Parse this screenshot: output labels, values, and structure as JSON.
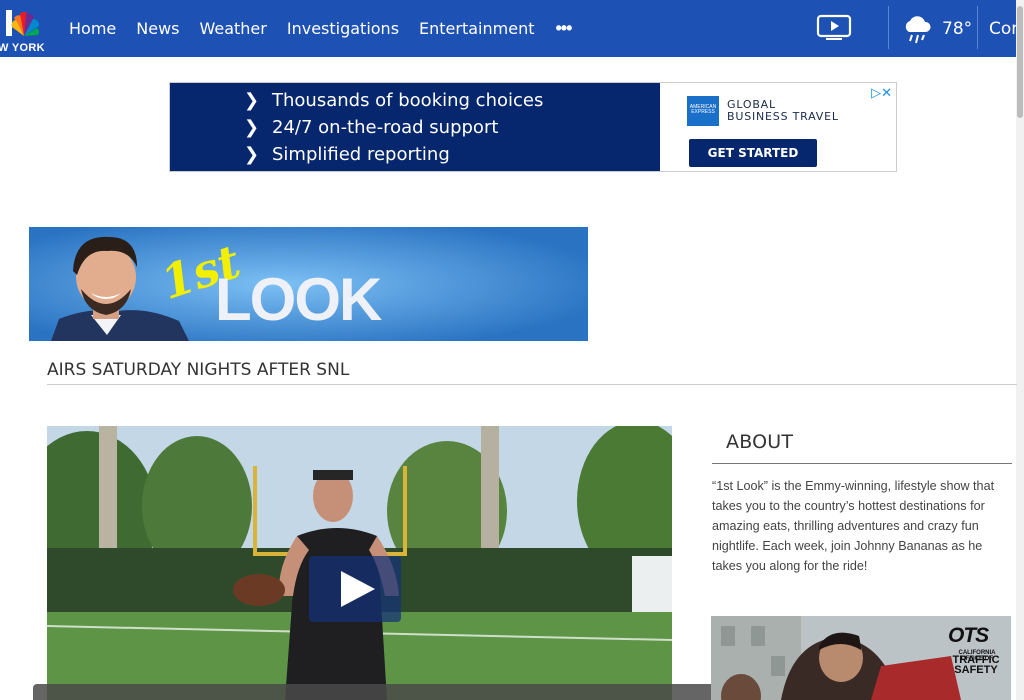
{
  "header": {
    "logo_text": "W YORK",
    "nav": [
      "Home",
      "News",
      "Weather",
      "Investigations",
      "Entertainment"
    ],
    "more_label": "•••",
    "temperature": "78°",
    "connect_label": "Conn"
  },
  "ad": {
    "lines": [
      "Thousands of booking choices",
      "24/7 on-the-road support",
      "Simplified reporting"
    ],
    "brand_line1": "GLOBAL",
    "brand_line2": "BUSINESS TRAVEL",
    "logo_text": "AMERICAN EXPRESS",
    "cta": "GET STARTED",
    "choices": "▷✕"
  },
  "banner": {
    "superscript": "1st",
    "word": "LOOK"
  },
  "subhead": "AIRS SATURDAY NIGHTS AFTER SNL",
  "about": {
    "title": "ABOUT",
    "text": "“1st Look” is the Emmy-winning, lifestyle show that takes you to the country’s hottest destinations for amazing eats, thrilling adventures and crazy fun nightlife. Each week, join Johnny Bananas as he takes you along for the ride!"
  },
  "side_ad": {
    "brand": "OTS",
    "sub": "CALIFORNIA OFFICE OF",
    "line1": "TRAFFIC",
    "line2": "SAFETY"
  },
  "colors": {
    "header": "#1e51b4",
    "ad_navy": "#06266d",
    "banner_blue": "#2f7fcc",
    "look_yellow": "#f2f000"
  }
}
